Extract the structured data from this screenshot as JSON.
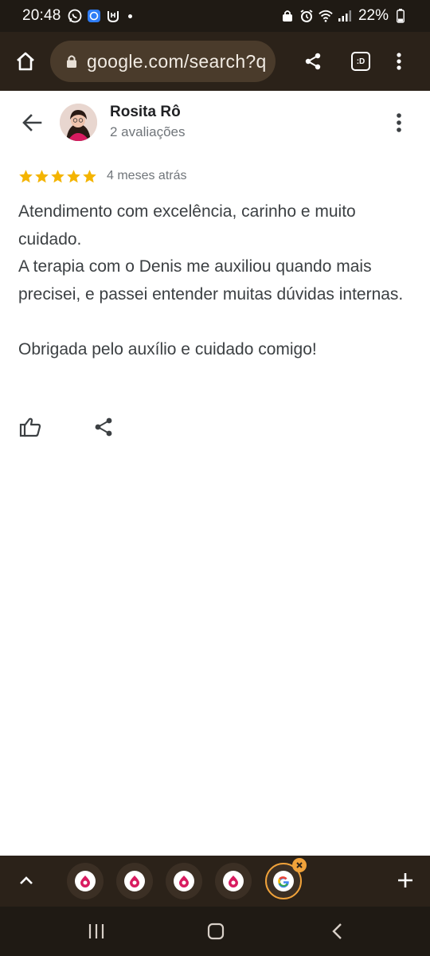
{
  "status_bar": {
    "time": "20:48",
    "battery": "22%",
    "left_icons": [
      "whatsapp-icon",
      "bixby-icon",
      "app-icon"
    ],
    "right_icons": [
      "lock-icon",
      "alarm-icon",
      "wifi-icon",
      "signal-icon",
      "battery-icon"
    ]
  },
  "browser": {
    "url": "google.com/search?q",
    "tabs_label": ":D"
  },
  "review": {
    "reviewer_name": "Rosita Rô",
    "review_count": "2 avaliações",
    "rating": 5,
    "rating_max": 5,
    "time_ago": "4 meses atrás",
    "text": "Atendimento com excelência, carinho e muito cuidado.\nA terapia com o Denis me auxiliou quando mais precisei, e passei entender muitas dúvidas internas.\n\nObrigada pelo auxílio e cuidado comigo!"
  },
  "colors": {
    "star": "#f4b400",
    "toolbar": "#2b2219",
    "omnibox": "#4a3b2b",
    "active_tab_ring": "#f0a23a",
    "favicon_accent": "#d81b60"
  },
  "tab_strip": {
    "tabs": [
      "favicon-pink",
      "favicon-pink",
      "favicon-pink",
      "favicon-pink",
      "google-favicon"
    ]
  }
}
